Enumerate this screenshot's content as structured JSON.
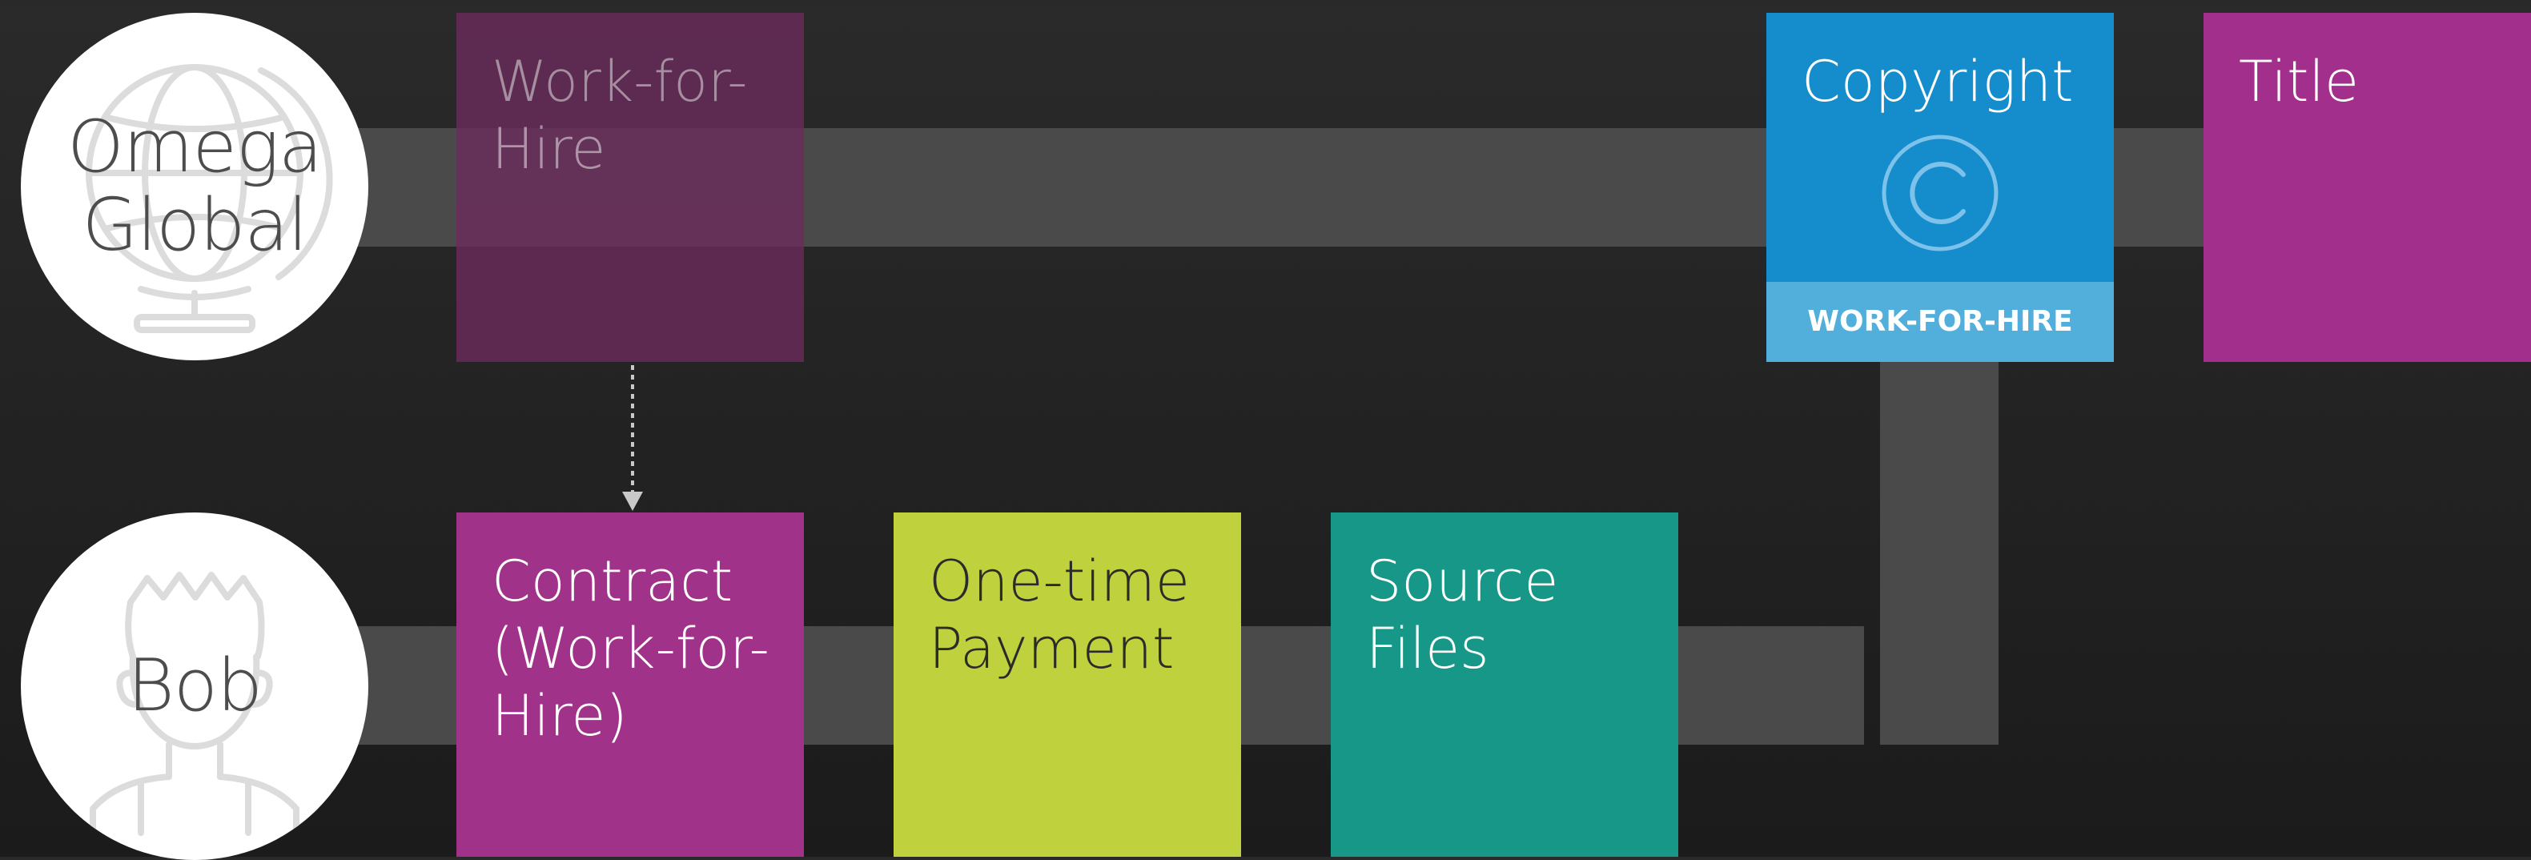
{
  "actors": {
    "company": {
      "name": "Omega Global",
      "icon": "globe-icon"
    },
    "freelancer": {
      "name": "Bob",
      "icon": "person-icon"
    }
  },
  "steps": {
    "work_for_hire_template": {
      "label": "Work-for-Hire",
      "color": "#6b2b5c"
    },
    "contract": {
      "label": "Contract (Work-for-Hire)",
      "color": "#a1328a"
    },
    "payment": {
      "label": "One-time Payment",
      "color": "#bfd13d"
    },
    "source_files": {
      "label": "Source Files",
      "color": "#179787"
    },
    "copyright": {
      "label": "Copyright",
      "footer": "WORK-FOR-HIRE",
      "icon": "copyright-icon",
      "color": "#158ccb"
    },
    "title": {
      "label": "Title",
      "color": "#a22f8b"
    }
  },
  "colors": {
    "background": "#222222",
    "lane": "#4a4a4a",
    "circle": "#ffffff",
    "actor_text": "#4d4d4d"
  }
}
